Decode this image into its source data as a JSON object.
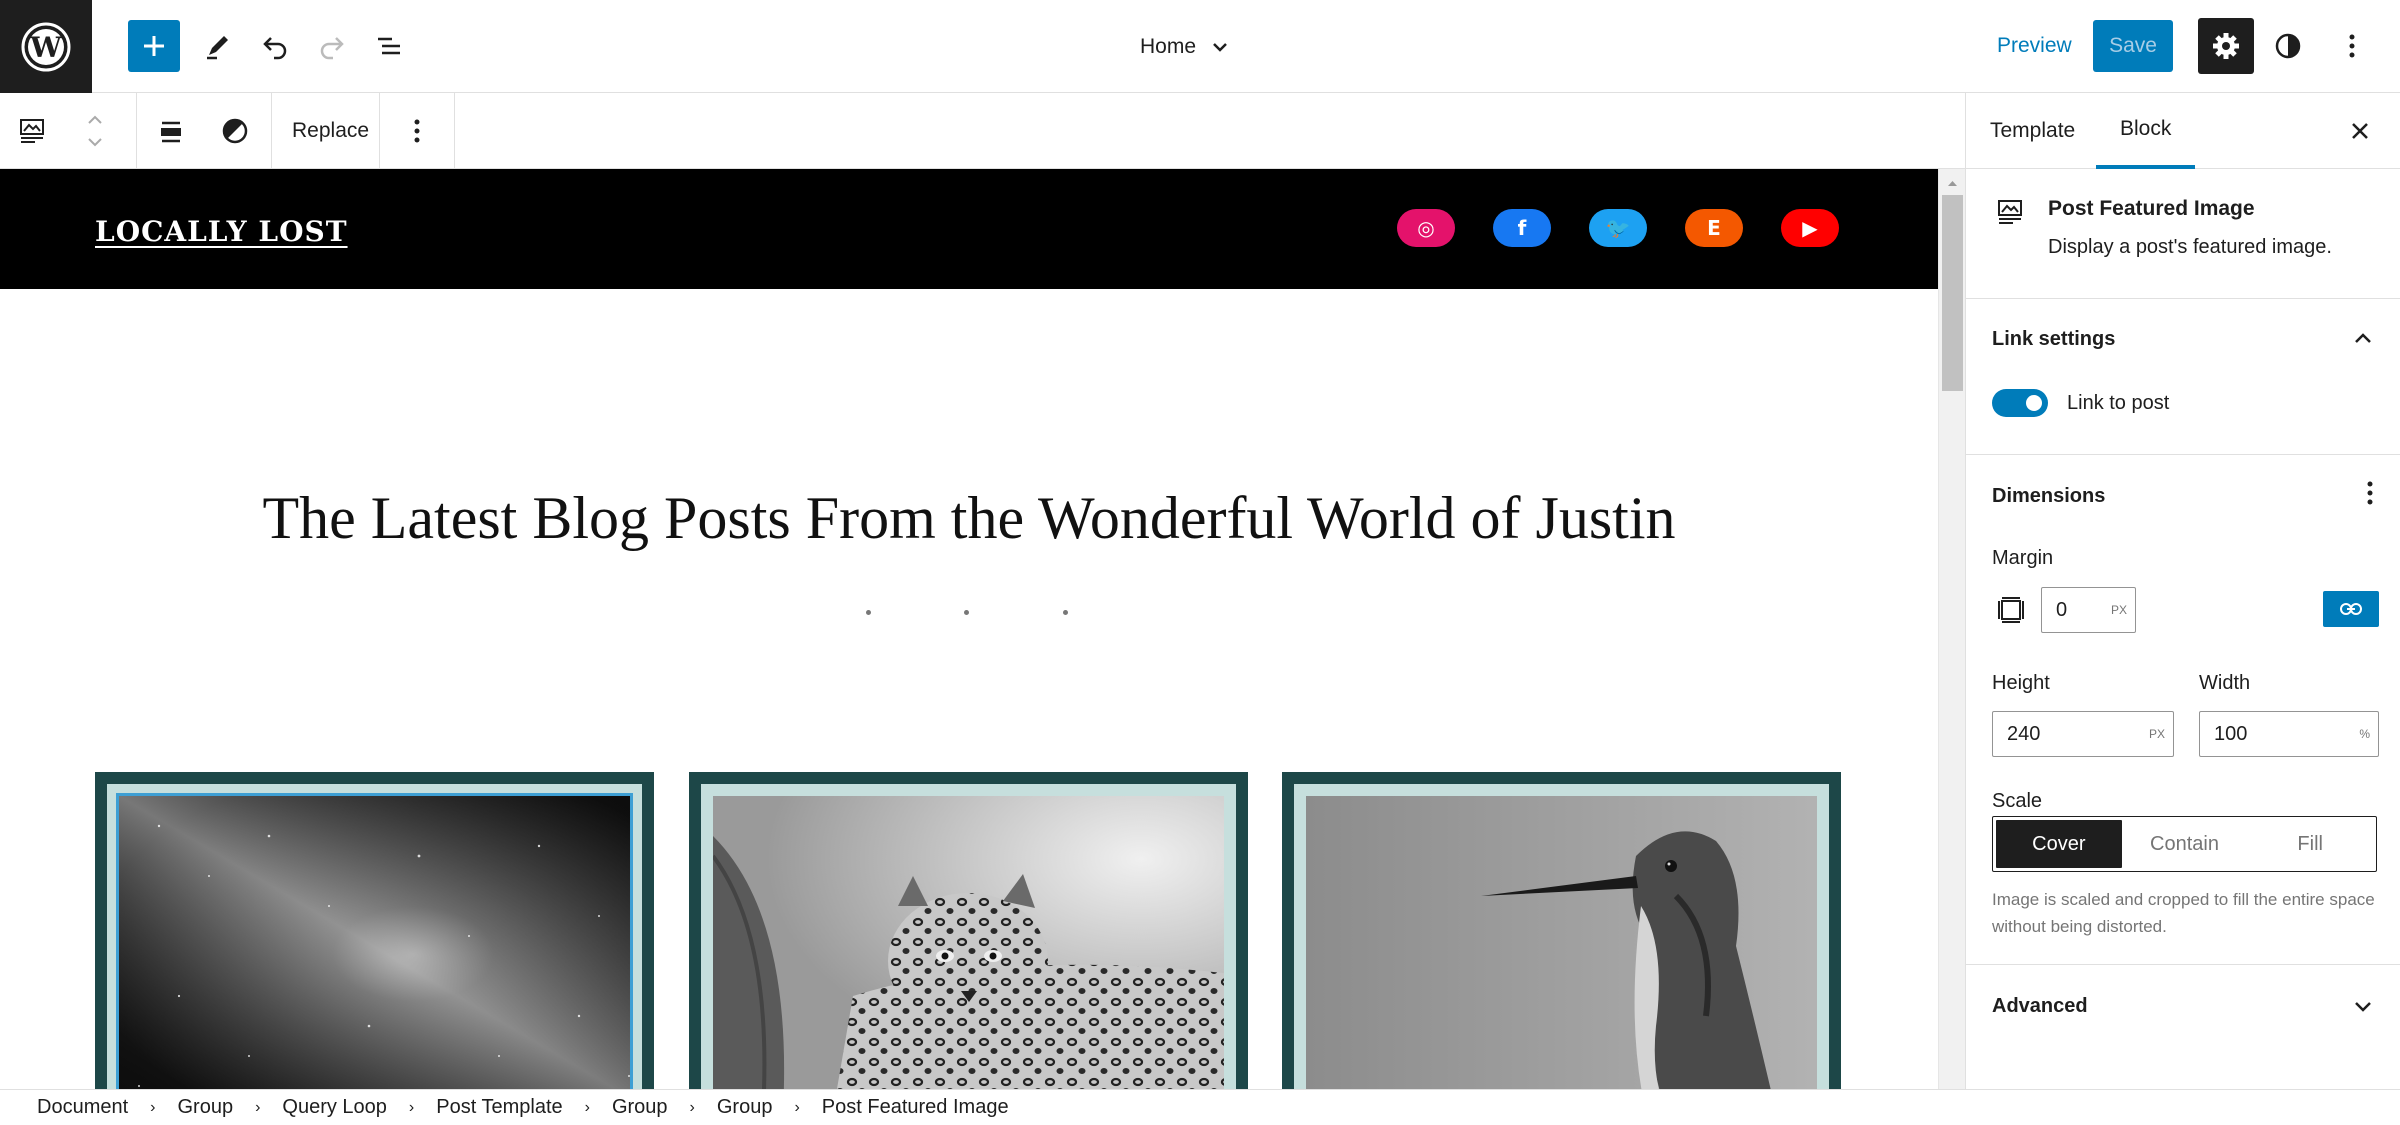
{
  "topbar": {
    "document_title": "Home",
    "preview_label": "Preview",
    "save_label": "Save"
  },
  "block_toolbar": {
    "replace_label": "Replace"
  },
  "site": {
    "title": "LOCALLY LOST",
    "social": [
      {
        "name": "instagram",
        "color": "#e4126b",
        "glyph": "◎"
      },
      {
        "name": "facebook",
        "color": "#1778f2",
        "glyph": "f"
      },
      {
        "name": "twitter",
        "color": "#1da1f2",
        "glyph": "🐦"
      },
      {
        "name": "etsy",
        "color": "#f45800",
        "glyph": "E"
      },
      {
        "name": "youtube",
        "color": "#ff0000",
        "glyph": "▶"
      }
    ],
    "hero_heading": "The Latest Blog Posts From the Wonderful World of Justin"
  },
  "sidebar": {
    "tabs": [
      "Template",
      "Block"
    ],
    "active_tab": "Block",
    "block": {
      "name": "Post Featured Image",
      "description": "Display a post's featured image."
    },
    "link_settings": {
      "heading": "Link settings",
      "toggle_label": "Link to post",
      "toggle_on": true
    },
    "dimensions": {
      "heading": "Dimensions",
      "margin_label": "Margin",
      "margin_value": "0",
      "margin_unit": "PX",
      "height_label": "Height",
      "height_value": "240",
      "height_unit": "PX",
      "width_label": "Width",
      "width_value": "100",
      "width_unit": "%",
      "scale_label": "Scale",
      "scale_options": [
        "Cover",
        "Contain",
        "Fill"
      ],
      "scale_selected": "Cover",
      "scale_help": "Image is scaled and cropped to fill the entire space without being distorted."
    },
    "advanced": {
      "heading": "Advanced"
    }
  },
  "breadcrumb": [
    "Document",
    "Group",
    "Query Loop",
    "Post Template",
    "Group",
    "Group",
    "Post Featured Image"
  ],
  "colors": {
    "accent": "#007cba",
    "card_frame": "#1d4748",
    "card_mat": "#c6dfdd"
  }
}
